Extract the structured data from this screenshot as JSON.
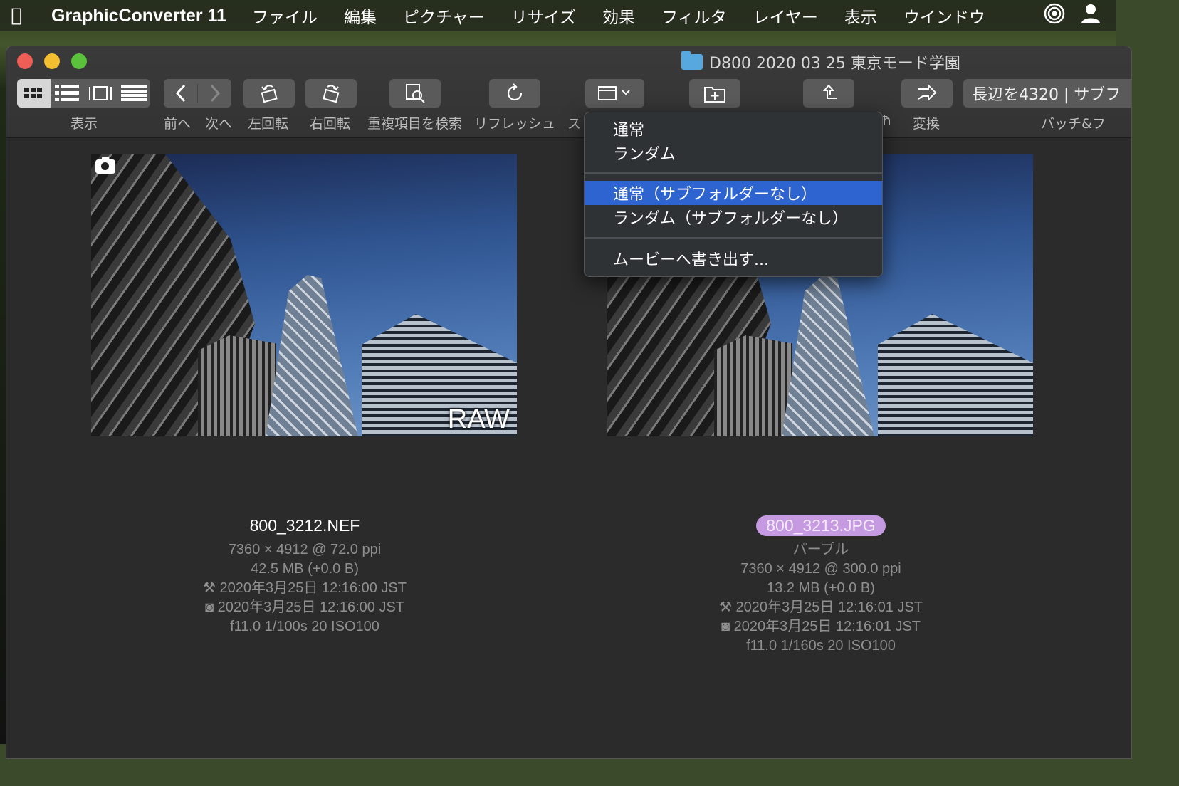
{
  "menubar": {
    "app_name": "GraphicConverter 11",
    "items": [
      "ファイル",
      "編集",
      "ピクチャー",
      "リサイズ",
      "効果",
      "フィルタ",
      "レイヤー",
      "表示",
      "ウインドウ"
    ]
  },
  "window": {
    "title": "D800 2020 03 25 東京モード学園"
  },
  "toolbar": {
    "view_label": "表示",
    "prev_label": "前へ",
    "next_label": "次へ",
    "rotate_left_label": "左回転",
    "rotate_right_label": "右回転",
    "find_duplicates_label": "重複項目を検索",
    "refresh_label": "リフレッシュ",
    "slideshow_label_partial": "ス",
    "move_label_partial": "ħ",
    "convert_label": "変換",
    "batch_button": "長辺を4320 | サブフ",
    "batch_label": "バッチ&フ"
  },
  "dropdown": {
    "items": [
      "通常",
      "ランダム",
      "通常（サブフォルダーなし）",
      "ランダム（サブフォルダーなし）",
      "ムービーへ書き出す..."
    ],
    "selected_index": 2
  },
  "files": [
    {
      "name": "800_3212.NEF",
      "badge": "RAW",
      "label": "",
      "dimensions": "7360 × 4912 @ 72.0 ppi",
      "size": "42.5 MB (+0.0 B)",
      "modified": "2020年3月25日 12:16:00 JST",
      "captured": "2020年3月25日 12:16:00 JST",
      "exposure": "f11.0 1/100s 20 ISO100"
    },
    {
      "name": "800_3213.JPG",
      "label": "パープル",
      "dimensions": "7360 × 4912 @ 300.0 ppi",
      "size": "13.2 MB (+0.0 B)",
      "modified": "2020年3月25日 12:16:01 JST",
      "captured": "2020年3月25日 12:16:01 JST",
      "exposure": "f11.0 1/160s 20 ISO100"
    }
  ],
  "colors": {
    "label_purple": "#c59ae0",
    "menu_selection": "#2e64cf"
  }
}
